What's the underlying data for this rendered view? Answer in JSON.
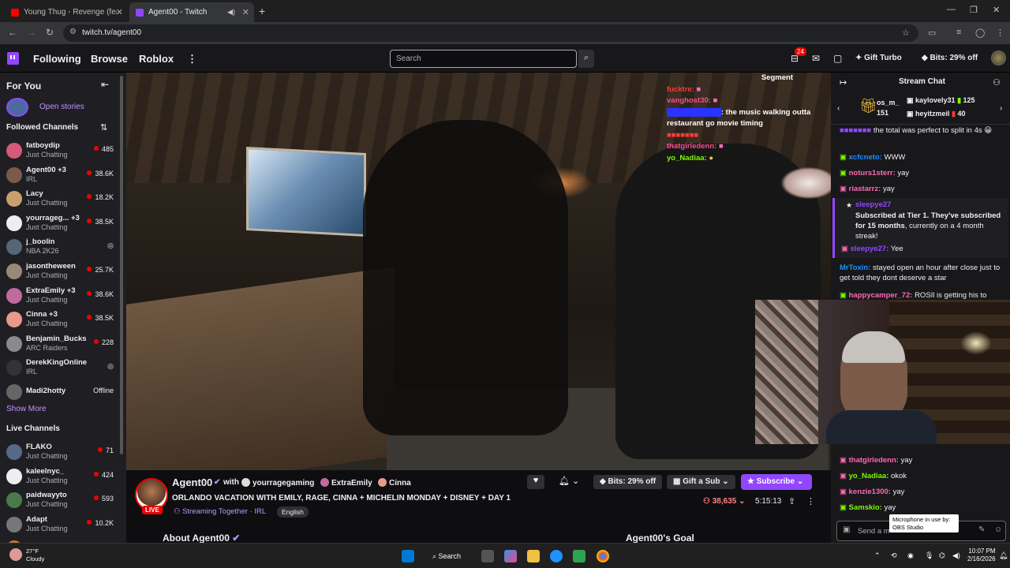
{
  "browser": {
    "tabs": [
      {
        "title": "Young Thug - Revenge (feat. Lil"
      },
      {
        "title": "Agent00 - Twitch"
      }
    ],
    "url": "twitch.tv/agent00"
  },
  "topnav": {
    "links": [
      "Following",
      "Browse",
      "Roblox"
    ],
    "search_placeholder": "Search",
    "notif_count": "24",
    "gift_turbo": "Gift Turbo",
    "bits": "Bits: 29% off"
  },
  "sidebar": {
    "for_you": "For You",
    "open_stories": "Open stories",
    "followed_header": "Followed Channels",
    "followed": [
      {
        "name": "fatboydip",
        "game": "Just Chatting",
        "viewers": "485",
        "color": "#d65a7a"
      },
      {
        "name": "Agent00 +3",
        "game": "IRL",
        "viewers": "38.6K",
        "color": "#7a5a48"
      },
      {
        "name": "Lacy",
        "game": "Just Chatting",
        "viewers": "18.2K",
        "color": "#c8a070"
      },
      {
        "name": "yourrageg... +3",
        "game": "Just Chatting",
        "viewers": "38.5K",
        "color": "#eeeeee"
      },
      {
        "name": "j_boolin",
        "game": "NBA 2K26",
        "viewers": "",
        "color": "#556677"
      },
      {
        "name": "jasontheween",
        "game": "Just Chatting",
        "viewers": "25.7K",
        "color": "#998877"
      },
      {
        "name": "ExtraEmily +3",
        "game": "Just Chatting",
        "viewers": "38.6K",
        "color": "#c06aa0"
      },
      {
        "name": "Cinna +3",
        "game": "Just Chatting",
        "viewers": "38.5K",
        "color": "#e89a8a"
      },
      {
        "name": "Benjamin_Bucks",
        "game": "ARC Raiders",
        "viewers": "228",
        "color": "#8a8a8a"
      },
      {
        "name": "DerekKingOnline",
        "game": "IRL",
        "viewers": "",
        "color": "#333333"
      },
      {
        "name": "Madi2hotty",
        "game": "",
        "viewers": "Offline",
        "color": "#666666"
      }
    ],
    "show_more": "Show More",
    "live_header": "Live Channels",
    "live": [
      {
        "name": "FLAKO",
        "game": "Just Chatting",
        "viewers": "71",
        "color": "#556a88"
      },
      {
        "name": "kaleelnyc_",
        "game": "Just Chatting",
        "viewers": "424",
        "color": "#eeeeee"
      },
      {
        "name": "paidwayyto",
        "game": "Just Chatting",
        "viewers": "593",
        "color": "#4a7a4a"
      },
      {
        "name": "Adapt",
        "game": "Just Chatting",
        "viewers": "10.2K",
        "color": "#777777"
      },
      {
        "name": "xQc",
        "game": "",
        "viewers": "28.1K",
        "color": "#bb7744"
      }
    ]
  },
  "overlay_chat": [
    {
      "user": "fuckt​re:",
      "msg": ""
    },
    {
      "user": "vanghost30:",
      "msg": ""
    },
    {
      "user": "",
      "msg": ": the music walking outta restaurant go movie timing"
    },
    {
      "user": "thatgirledenn:",
      "msg": ""
    },
    {
      "user": "yo_Nadiaa:",
      "msg": ""
    }
  ],
  "overlay_top": "Segment",
  "stream": {
    "channel": "Agent00",
    "with": "with",
    "collabs": [
      "yourragegaming",
      "ExtraEmily",
      "Cinna"
    ],
    "title": "ORLANDO VACATION WITH EMILY, RAGE, CINNA + MICHELIN MONDAY + DISNEY + DAY 1",
    "category": "Streaming Together · IRL",
    "tag": "English",
    "live": "LIVE",
    "viewers": "38,635",
    "uptime": "5:15:13",
    "bits_btn": "Bits: 29% off",
    "gift_btn": "Gift a Sub",
    "subscribe_btn": "Subscribe",
    "about": "About Agent00",
    "goal": "Agent00's Goal"
  },
  "chat": {
    "header": "Stream Chat",
    "hype": [
      {
        "name": "kaylovely31",
        "amount": "125"
      },
      {
        "name": "heyitzmeil",
        "amount": "40"
      }
    ],
    "hype_left": "os_m_",
    "hype_left_num": "151",
    "messages": [
      {
        "user": "",
        "text": "the total was perfect to split in 4s",
        "color": "#9147ff"
      },
      {
        "user": "xcfcneto:",
        "text": "WWW",
        "color": "#1e90ff"
      },
      {
        "user": "noturs1sterr:",
        "text": "yay",
        "color": "#ff69b4"
      },
      {
        "user": "riastarrz:",
        "text": "yay",
        "color": "#ff69b4"
      },
      {
        "user": "sleepye27:",
        "text": "Yee",
        "color": "#9147ff"
      },
      {
        "user": "MrToxin:",
        "text": "stayed open an hour after close just to get told they dont deserve a star",
        "color": "#1e90ff"
      },
      {
        "user": "happycamper_72:",
        "text": "ROSIl is getting his to",
        "color": "#ff69b4"
      },
      {
        "user": "thatgirledenn:",
        "text": "yay",
        "color": "#ff69b4"
      },
      {
        "user": "yo_Nadiaa:",
        "text": "okok",
        "color": "#7cfc00"
      },
      {
        "user": "kenzie1300:",
        "text": "yay",
        "color": "#ff69b4"
      },
      {
        "user": "Samskio:",
        "text": "yay",
        "color": "#7cfc00"
      }
    ],
    "sub_alert": {
      "user": "sleepye27",
      "line1": "Subscribed at Tier 1. They've subscribed for",
      "months": "15 months",
      "line2": ", currently on a 4 month streak!"
    },
    "input_placeholder": "Send a m",
    "tooltip": "Microphone in use by: OBS Studio"
  },
  "taskbar": {
    "weather_temp": "27°F",
    "weather_desc": "Cloudy",
    "search": "Search",
    "time": "10:07 PM",
    "date": "2/16/2026"
  }
}
